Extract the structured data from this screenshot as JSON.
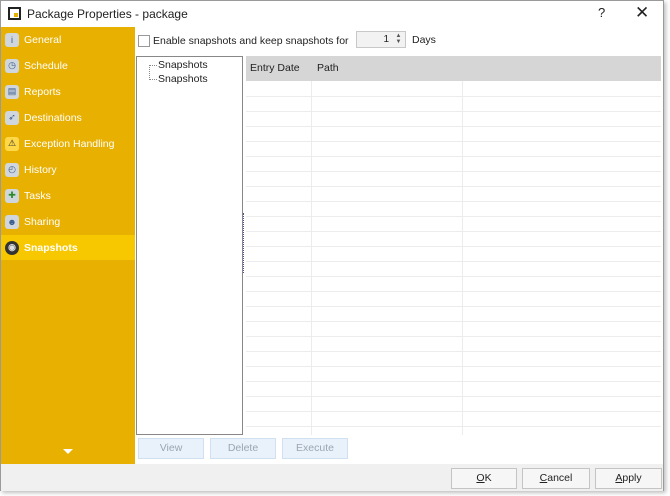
{
  "window": {
    "title": "Package Properties - package",
    "help": "?",
    "close": "✕"
  },
  "sidebar": {
    "items": [
      {
        "label": "General",
        "icon": "info-icon",
        "glyph": "i"
      },
      {
        "label": "Schedule",
        "icon": "clock-icon",
        "glyph": "◷"
      },
      {
        "label": "Reports",
        "icon": "reports-icon",
        "glyph": "▤"
      },
      {
        "label": "Destinations",
        "icon": "destinations-icon",
        "glyph": "➶"
      },
      {
        "label": "Exception Handling",
        "icon": "warning-icon",
        "glyph": "⚠"
      },
      {
        "label": "History",
        "icon": "history-icon",
        "glyph": "◴"
      },
      {
        "label": "Tasks",
        "icon": "tasks-icon",
        "glyph": "✚"
      },
      {
        "label": "Sharing",
        "icon": "sharing-icon",
        "glyph": "☻"
      },
      {
        "label": "Snapshots",
        "icon": "camera-icon",
        "glyph": "◉",
        "selected": true
      }
    ]
  },
  "options": {
    "enable_label": "Enable snapshots and keep snapshots for",
    "enabled": false,
    "days_value": "1",
    "days_label": "Days"
  },
  "tree": {
    "nodes": [
      "Snapshots",
      "Snapshots"
    ]
  },
  "grid": {
    "columns": [
      "Entry Date",
      "Path",
      ""
    ]
  },
  "actions": {
    "view": "View",
    "delete": "Delete",
    "execute": "Execute"
  },
  "footer": {
    "ok_key": "O",
    "ok_rest": "K",
    "cancel_key": "C",
    "cancel_rest": "ancel",
    "apply_key": "A",
    "apply_rest": "pply"
  },
  "colors": {
    "sidebar": "#e8b000",
    "selected": "#f7c800"
  }
}
